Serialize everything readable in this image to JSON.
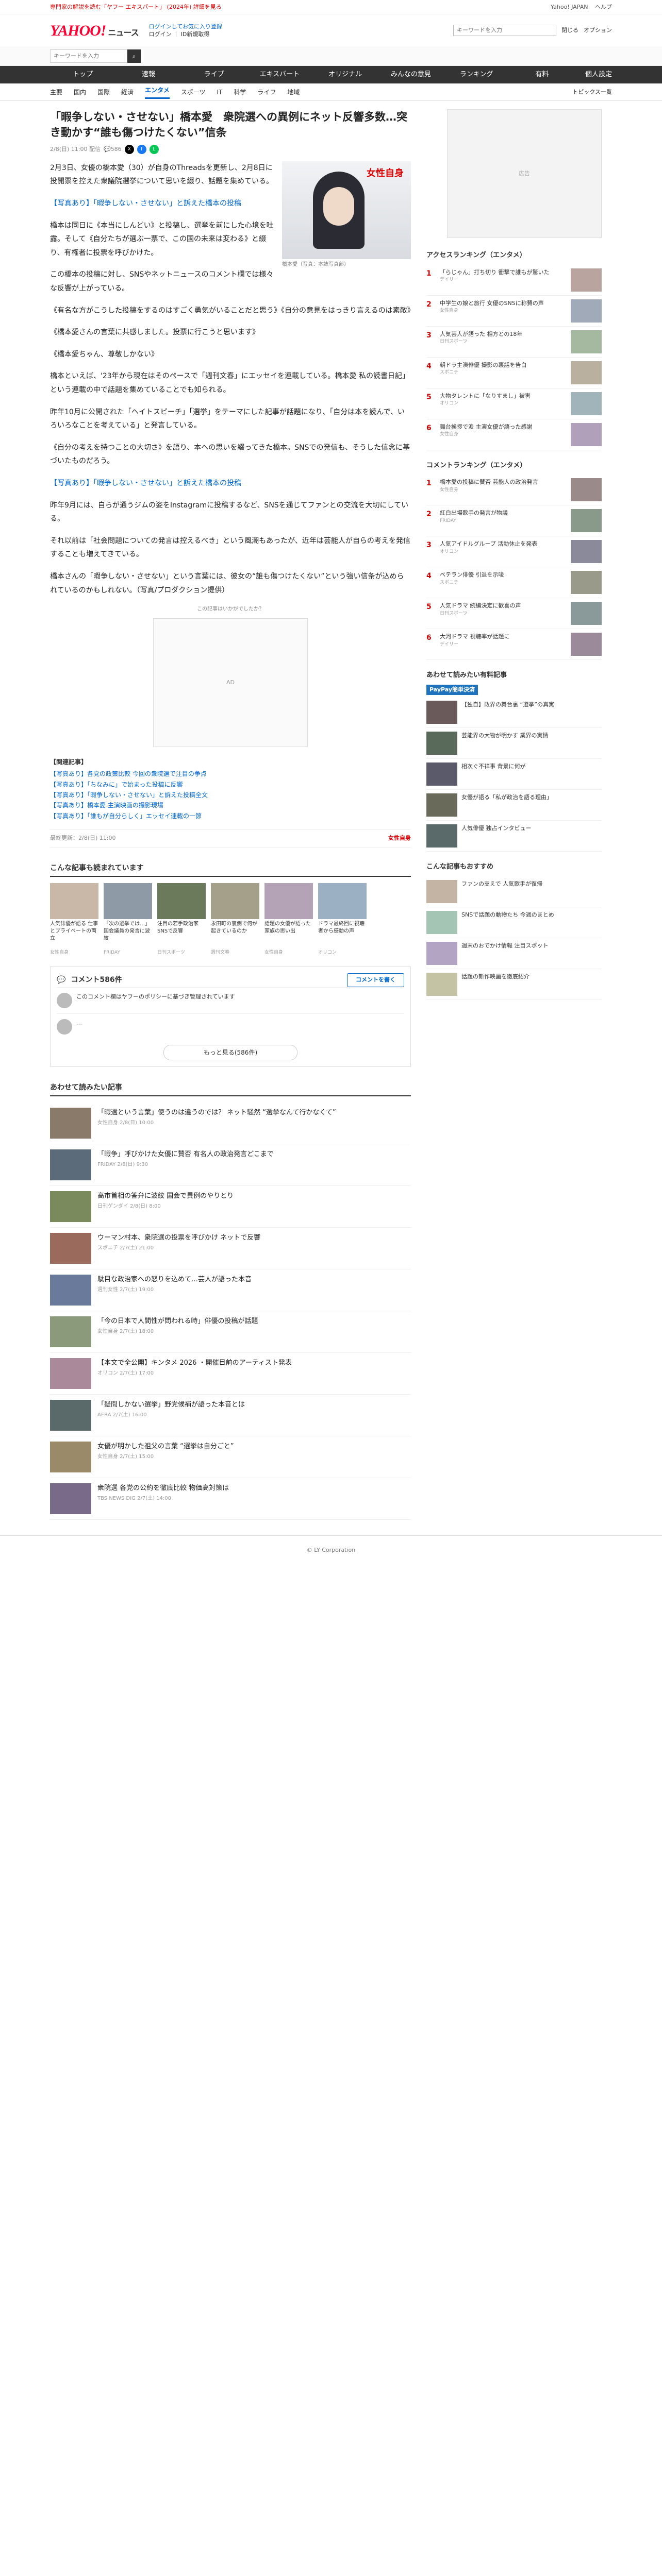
{
  "topbar": {
    "promo": "専門家の解説を読む「ヤフー エキスパート」 (2024年) 詳細を見る",
    "links": [
      "Yahoo! JAPAN",
      "ヘルプ"
    ]
  },
  "header": {
    "logo": "YAHOO!",
    "logo_sub": "ニュース",
    "links": [
      "ログインしてお気に入り登録",
      "ログイン",
      "ID新規取得"
    ],
    "search_placeholder": "キーワードを入力",
    "right": [
      "閉じる",
      "オプション"
    ]
  },
  "search": {
    "placeholder": "キーワードを入力"
  },
  "gnav": {
    "items": [
      "トップ",
      "速報",
      "ライブ",
      "エキスパート",
      "オリジナル",
      "みんなの意見",
      "ランキング",
      "有料"
    ],
    "active": 4,
    "right": "個人設定"
  },
  "subnav": {
    "items": [
      "主要",
      "国内",
      "国際",
      "経済",
      "エンタメ",
      "スポーツ",
      "IT",
      "科学",
      "ライフ",
      "地域"
    ],
    "active": 4,
    "right": "トピックス一覧"
  },
  "article": {
    "title": "「暇争しない・させない」橋本愛　衆院選への異例にネット反響多数…突き動かす“誰も傷つけたくない”信条",
    "date": "2/8(日) 11:00 配信",
    "comments": "586",
    "photo_brand": "女性自身",
    "photo_caption": "橋本愛（写真：本誌写真部）",
    "paragraphs": [
      "2月3日、女優の橋本愛（30）が自身のThreadsを更新し、2月8日に投開票を控えた衆議院選挙について思いを綴り、話題を集めている。",
      "【写真あり】「暇争しない・させない」と訴えた橋本の投稿",
      "橋本は同日に《本当にしんどい》と投稿し、選挙を前にした心境を吐露。そして《自分たちが選ぶ一票で、この国の未来は変わる》と綴り、有権者に投票を呼びかけた。",
      "この橋本の投稿に対し、SNSやネットニュースのコメント欄では様々な反響が上がっている。",
      "《有名な方がこうした投稿をするのはすごく勇気がいることだと思う》《自分の意見をはっきり言えるのは素敵》",
      "《橋本愛さんの言葉に共感しました。投票に行こうと思います》",
      "《橋本愛ちゃん、尊敬しかない》",
      "橋本といえば、'23年から現在はそのペースで「週刊文春」にエッセイを連載している。橋本愛 私の読書日記」という連載の中で話題を集めていることでも知られる。",
      "昨年10月に公開された「ヘイトスピーチ」「選挙」をテーマにした記事が話題になり、「自分は本を読んで、いろいろなことを考えている」と発言している。",
      "《自分の考えを持つことの大切さ》を語り、本への思いを綴ってきた橋本。SNSでの発信も、そうした信念に基づいたものだろう。",
      "【写真あり】「暇争しない・させない」と訴えた橋本の投稿",
      "昨年9月には、自らが通うジムの姿をInstagramに投稿するなど、SNSを通じてファンとの交流を大切にしている。",
      "それ以前は「社会問題についての発言は控えるべき」という風潮もあったが、近年は芸能人が自らの考えを発信することも増えてきている。",
      "橋本さんの「暇争しない・させない」という言葉には、彼女の“誰も傷つけたくない”という強い信条が込められているのかもしれない。（写真/プロダクション提供）"
    ],
    "ad_note": "この記事はいかがでしたか？",
    "related_heading": "【関連記事】",
    "related": [
      "【写真あり】各党の政策比較 今回の衆院選で注目の争点",
      "【写真あり】「ちなみに」で始まった投稿に反響",
      "【写真あり】「暇争しない・させない」と訴えた投稿全文",
      "【写真あり】橋本愛 主演映画の撮影現場",
      "【写真あり】「誰もが自分らしく」エッセイ連載の一節"
    ],
    "provider": "女性自身",
    "last_updated": "最終更新：2/8(日) 11:00"
  },
  "also_read": {
    "heading": "こんな記事も読まれています",
    "cards": [
      {
        "t": "人気俳優が語る 仕事とプライベートの両立",
        "s": "女性自身"
      },
      {
        "t": "「次の選挙では…」国会議員の発言に波紋",
        "s": "FRIDAY"
      },
      {
        "t": "注目の若手政治家 SNSで反響",
        "s": "日刊スポーツ"
      },
      {
        "t": "永田町の裏側で何が起きているのか",
        "s": "週刊文春"
      },
      {
        "t": "話題の女優が語った家族の思い出",
        "s": "女性自身"
      },
      {
        "t": "ドラマ最終回に視聴者から感動の声",
        "s": "オリコン"
      }
    ]
  },
  "comments": {
    "heading": "コメント586件",
    "btn": "コメントを書く",
    "notice": "このコメント欄はヤフーのポリシーに基づき管理されています",
    "more": "もっと見る(586件)"
  },
  "recommend": {
    "heading": "あわせて読みたい記事",
    "items": [
      {
        "t": "「暇選という言葉」使うのは違うのでは？ ネット騒然 “選挙なんて行かなくて”",
        "s": "女性自身 2/8(日) 10:00"
      },
      {
        "t": "「暇争」呼びかけた女優に賛否 有名人の政治発言どこまで",
        "s": "FRIDAY 2/8(日) 9:30"
      },
      {
        "t": "高市首相の答弁に波紋 国会で異例のやりとり",
        "s": "日刊ゲンダイ 2/8(日) 8:00"
      },
      {
        "t": "ウーマン村本、衆院選の投票を呼びかけ ネットで反響",
        "s": "スポニチ 2/7(土) 21:00"
      },
      {
        "t": "駄目な政治家への怒りを込めて…芸人が語った本音",
        "s": "週刊女性 2/7(土) 19:00"
      },
      {
        "t": "「今の日本で人間性が問われる時」俳優の投稿が話題",
        "s": "女性自身 2/7(土) 18:00"
      },
      {
        "t": "【本文で全公開】キンタメ 2026 ・開催目前のアーティスト発表",
        "s": "オリコン 2/7(土) 17:00"
      },
      {
        "t": "「疑問しかない選挙」野党候補が語った本音とは",
        "s": "AERA 2/7(土) 16:00"
      },
      {
        "t": "女優が明かした祖父の言葉 “選挙は自分ごと”",
        "s": "女性自身 2/7(土) 15:00"
      },
      {
        "t": "衆院選 各党の公約を徹底比較 物価高対策は",
        "s": "TBS NEWS DIG 2/7(土) 14:00"
      }
    ]
  },
  "sidebar": {
    "ad": "広告",
    "access_heading": "アクセスランキング（エンタメ）",
    "access": [
      {
        "t": "「らじゃん」打ち切り 衝撃で誰もが驚いた",
        "s": "デイリー"
      },
      {
        "t": "中学生の娘と旅行 女優のSNSに称賛の声",
        "s": "女性自身"
      },
      {
        "t": "人気芸人が語った 相方との18年",
        "s": "日刊スポーツ"
      },
      {
        "t": "朝ドラ主演俳優 撮影の裏話を告白",
        "s": "スポニチ"
      },
      {
        "t": "大物タレントに「なりすまし」被害",
        "s": "オリコン"
      },
      {
        "t": "舞台挨拶で涙 主演女優が語った感謝",
        "s": "女性自身"
      }
    ],
    "comment_heading": "コメントランキング（エンタメ）",
    "comment": [
      {
        "t": "橋本愛の投稿に賛否 芸能人の政治発言",
        "s": "女性自身"
      },
      {
        "t": "紅白出場歌手の発言が物議",
        "s": "FRIDAY"
      },
      {
        "t": "人気アイドルグループ 活動休止を発表",
        "s": "オリコン"
      },
      {
        "t": "ベテラン俳優 引退を示唆",
        "s": "スポニチ"
      },
      {
        "t": "人気ドラマ 続編決定に歓喜の声",
        "s": "日刊スポーツ"
      },
      {
        "t": "大河ドラマ 視聴率が話題に",
        "s": "デイリー"
      }
    ],
    "pickup_heading": "あわせて読みたい有料記事",
    "pickup_badge": "PayPay簡単決済",
    "pickup": [
      {
        "t": "【独自】政界の舞台裏 “選挙”の真実"
      },
      {
        "t": "芸能界の大物が明かす 業界の実情"
      },
      {
        "t": "相次ぐ不祥事 背景に何が"
      },
      {
        "t": "女優が語る「私が政治を語る理由」"
      },
      {
        "t": "人気俳優 独占インタビュー"
      }
    ],
    "team_heading": "こんな記事もおすすめ",
    "team": [
      {
        "t": "ファンの支えで 人気歌手が復帰"
      },
      {
        "t": "SNSで話題の動物たち 今週のまとめ"
      },
      {
        "t": "週末のおでかけ情報 注目スポット"
      },
      {
        "t": "話題の新作映画を徹底紹介"
      }
    ]
  },
  "footer": {
    "copy": "© LY Corporation"
  }
}
